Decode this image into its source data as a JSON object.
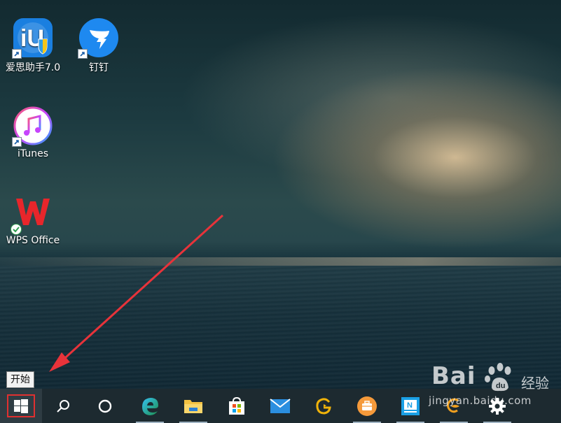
{
  "desktop": {
    "icons": [
      {
        "label": "爱思助手7.0"
      },
      {
        "label": "钉钉"
      },
      {
        "label": "iTunes"
      },
      {
        "label": "WPS Office"
      }
    ]
  },
  "tooltip": {
    "text": "开始"
  },
  "taskbar": {
    "items": [
      {
        "icon": "windows-logo-icon"
      },
      {
        "icon": "search-icon"
      },
      {
        "icon": "cortana-icon"
      },
      {
        "icon": "edge-icon"
      },
      {
        "icon": "file-explorer-icon"
      },
      {
        "icon": "microsoft-store-icon"
      },
      {
        "icon": "mail-icon"
      },
      {
        "icon": "app-g-icon"
      },
      {
        "icon": "briefcase-app-icon"
      },
      {
        "icon": "news-app-icon"
      },
      {
        "icon": "orange-app-icon"
      },
      {
        "icon": "settings-icon"
      }
    ]
  },
  "watermark": {
    "brand": "Bai",
    "brand_suffix": "经验",
    "url": "jingyan.baidu.com"
  },
  "colors": {
    "taskbar_bg": "#1d2a30",
    "highlight_red": "#e03030",
    "arrow_red": "#e8333a"
  }
}
